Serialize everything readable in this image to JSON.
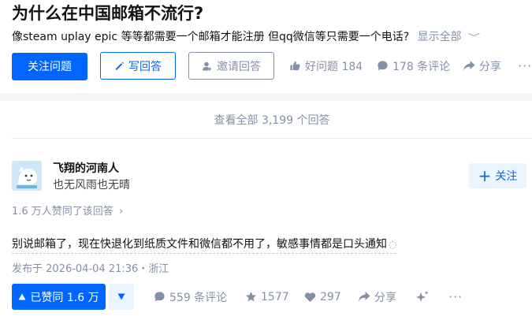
{
  "question": {
    "title": "为什么在中国邮箱不流行?",
    "description": "像steam uplay epic 等等都需要一个邮箱才能注册 但qq微信等只需要一个电话?",
    "show_all": "显示全部"
  },
  "question_actions": {
    "follow": "关注问题",
    "write_answer": "写回答",
    "invite": "邀请回答",
    "good_question": "好问题 184",
    "comments": "178 条评论",
    "share": "分享",
    "more": "···"
  },
  "view_all": "查看全部 3,199 个回答",
  "answer": {
    "author": {
      "name": "飞翔的河南人",
      "bio": "也无风雨也无晴",
      "follow": "关注"
    },
    "voters": "1.6 万人赞同了该回答",
    "content": "别说邮箱了，现在快退化到纸质文件和微信都不用了，敏感事情都是口头通知",
    "published": "发布于 2026-04-04 21:36・浙江",
    "actions": {
      "upvote": "已赞同 1.6 万",
      "comments": "559 条评论",
      "collect": "1577",
      "like": "297",
      "share": "分享",
      "more": "···"
    }
  },
  "colors": {
    "brand": "#0066ff",
    "muted": "#8590a6",
    "brand_light": "#ebf5ff"
  }
}
